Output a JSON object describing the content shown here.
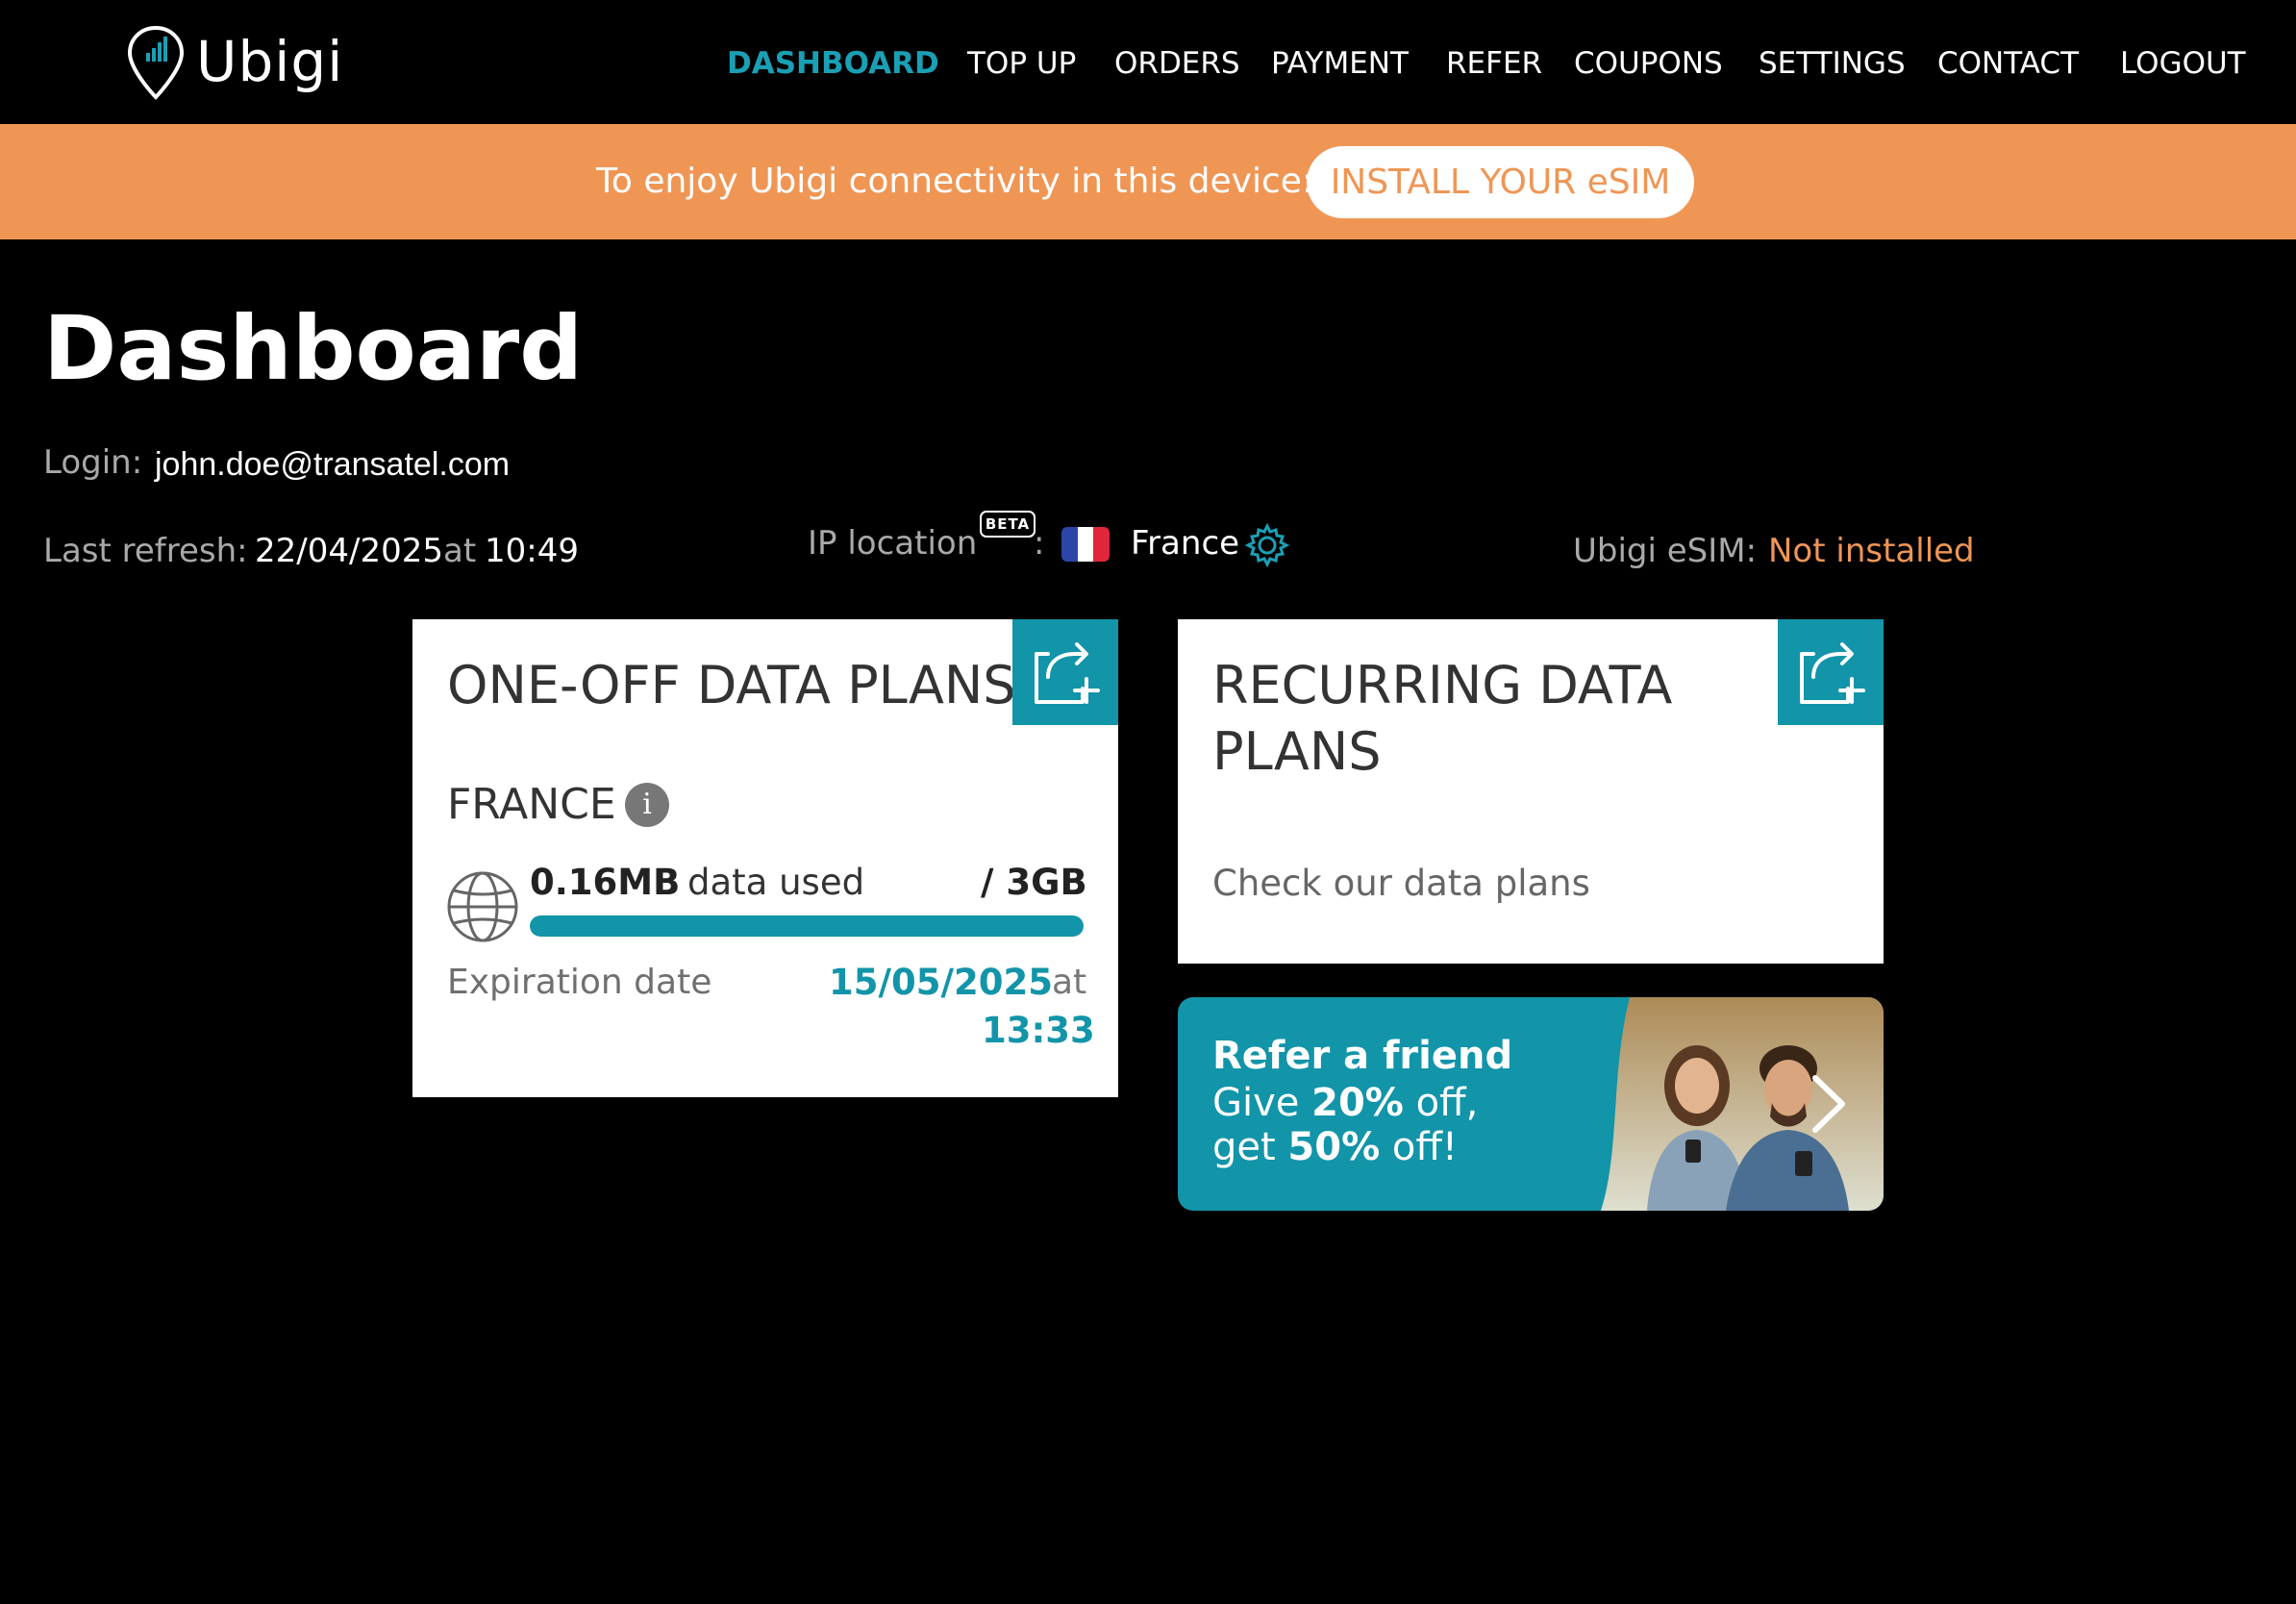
{
  "app": {
    "logo_text": "Ubigi"
  },
  "nav": {
    "items": [
      {
        "label": "DASHBOARD",
        "active": true
      },
      {
        "label": "TOP UP",
        "active": false
      },
      {
        "label": "ORDERS",
        "active": false
      },
      {
        "label": "PAYMENT",
        "active": false
      },
      {
        "label": "REFER",
        "active": false
      },
      {
        "label": "COUPONS",
        "active": false
      },
      {
        "label": "SETTINGS",
        "active": false
      },
      {
        "label": "CONTACT",
        "active": false
      },
      {
        "label": "LOGOUT",
        "active": false
      }
    ]
  },
  "banner": {
    "text": "To enjoy Ubigi connectivity in this device:",
    "button_label": "INSTALL YOUR eSIM"
  },
  "page": {
    "title": "Dashboard",
    "login_label": "Login:",
    "login_value": "john.doe@transatel.com",
    "last_refresh_label": "Last refresh:",
    "last_refresh_date": "22/04/2025",
    "last_refresh_at": "at",
    "last_refresh_time": "10:49",
    "ip_location_label": "IP location",
    "ip_location_badge": "BETA",
    "ip_location_colon": ":",
    "ip_location_country": "France",
    "esim_label": "Ubigi eSIM:",
    "esim_status": "Not installed"
  },
  "one_off_card": {
    "title": "ONE-OFF DATA PLANS",
    "country": "FRANCE",
    "info_icon": "i",
    "used_amount": "0.16MB",
    "used_label": "data used",
    "total_amount": "/ 3GB",
    "usage_fraction": 0.9999,
    "expiration_label": "Expiration date",
    "expiration_date": "15/05/2025",
    "expiration_at": "at",
    "expiration_time": "13:33"
  },
  "recurring_card": {
    "title_line1": "RECURRING DATA",
    "title_line2": "PLANS",
    "link": "Check our data plans"
  },
  "refer_banner": {
    "title": "Refer a friend",
    "line1_pre": "Give ",
    "line1_bold": "20%",
    "line1_post": " off,",
    "line2_pre": "get ",
    "line2_bold": "50%",
    "line2_post": " off!"
  },
  "colors": {
    "accent": "#1294a9",
    "nav_active": "#1aa0b5",
    "banner": "#ef9655",
    "status_warning": "#ef9655"
  },
  "icons": {
    "logo": "location-pin-signal-icon",
    "settings": "gear-icon",
    "add_plan": "add-to-box-icon",
    "data": "globe-icon",
    "info": "info-icon",
    "refer_next": "chevron-right-icon",
    "flag": "france-flag-icon"
  }
}
